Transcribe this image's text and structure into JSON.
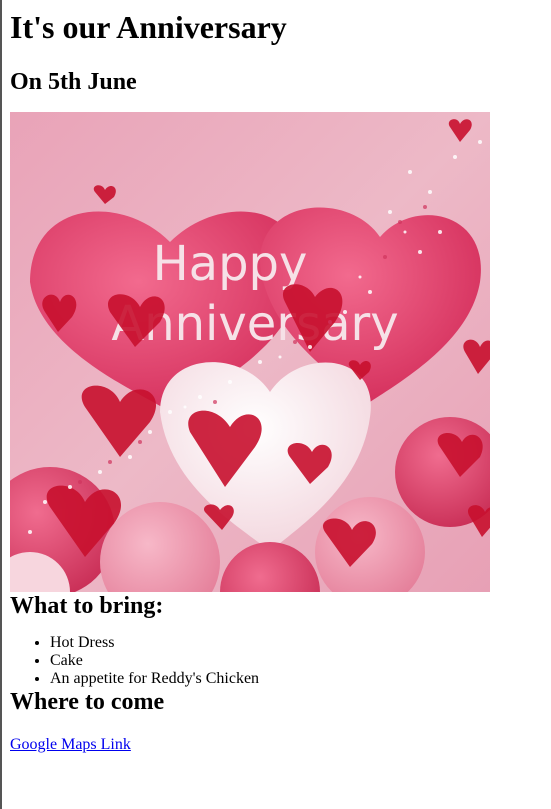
{
  "page": {
    "title": "It's our Anniversary",
    "date_line": "On 5th June"
  },
  "hero_image": {
    "text_line1": "Happy",
    "text_line2": "Anniversary",
    "colors": {
      "background": "#E8A9BC",
      "heart_pink": "#E2406C",
      "heart_red": "#C01530",
      "heart_white": "#F8EEF0"
    }
  },
  "bring": {
    "heading": "What to bring:",
    "items": [
      "Hot Dress",
      "Cake",
      "An appetite for Reddy's Chicken"
    ]
  },
  "where": {
    "heading": "Where to come",
    "link_text": "Google Maps Link"
  },
  "colors": {
    "link": "#0000EE",
    "text": "#000000",
    "border": "#555555"
  }
}
